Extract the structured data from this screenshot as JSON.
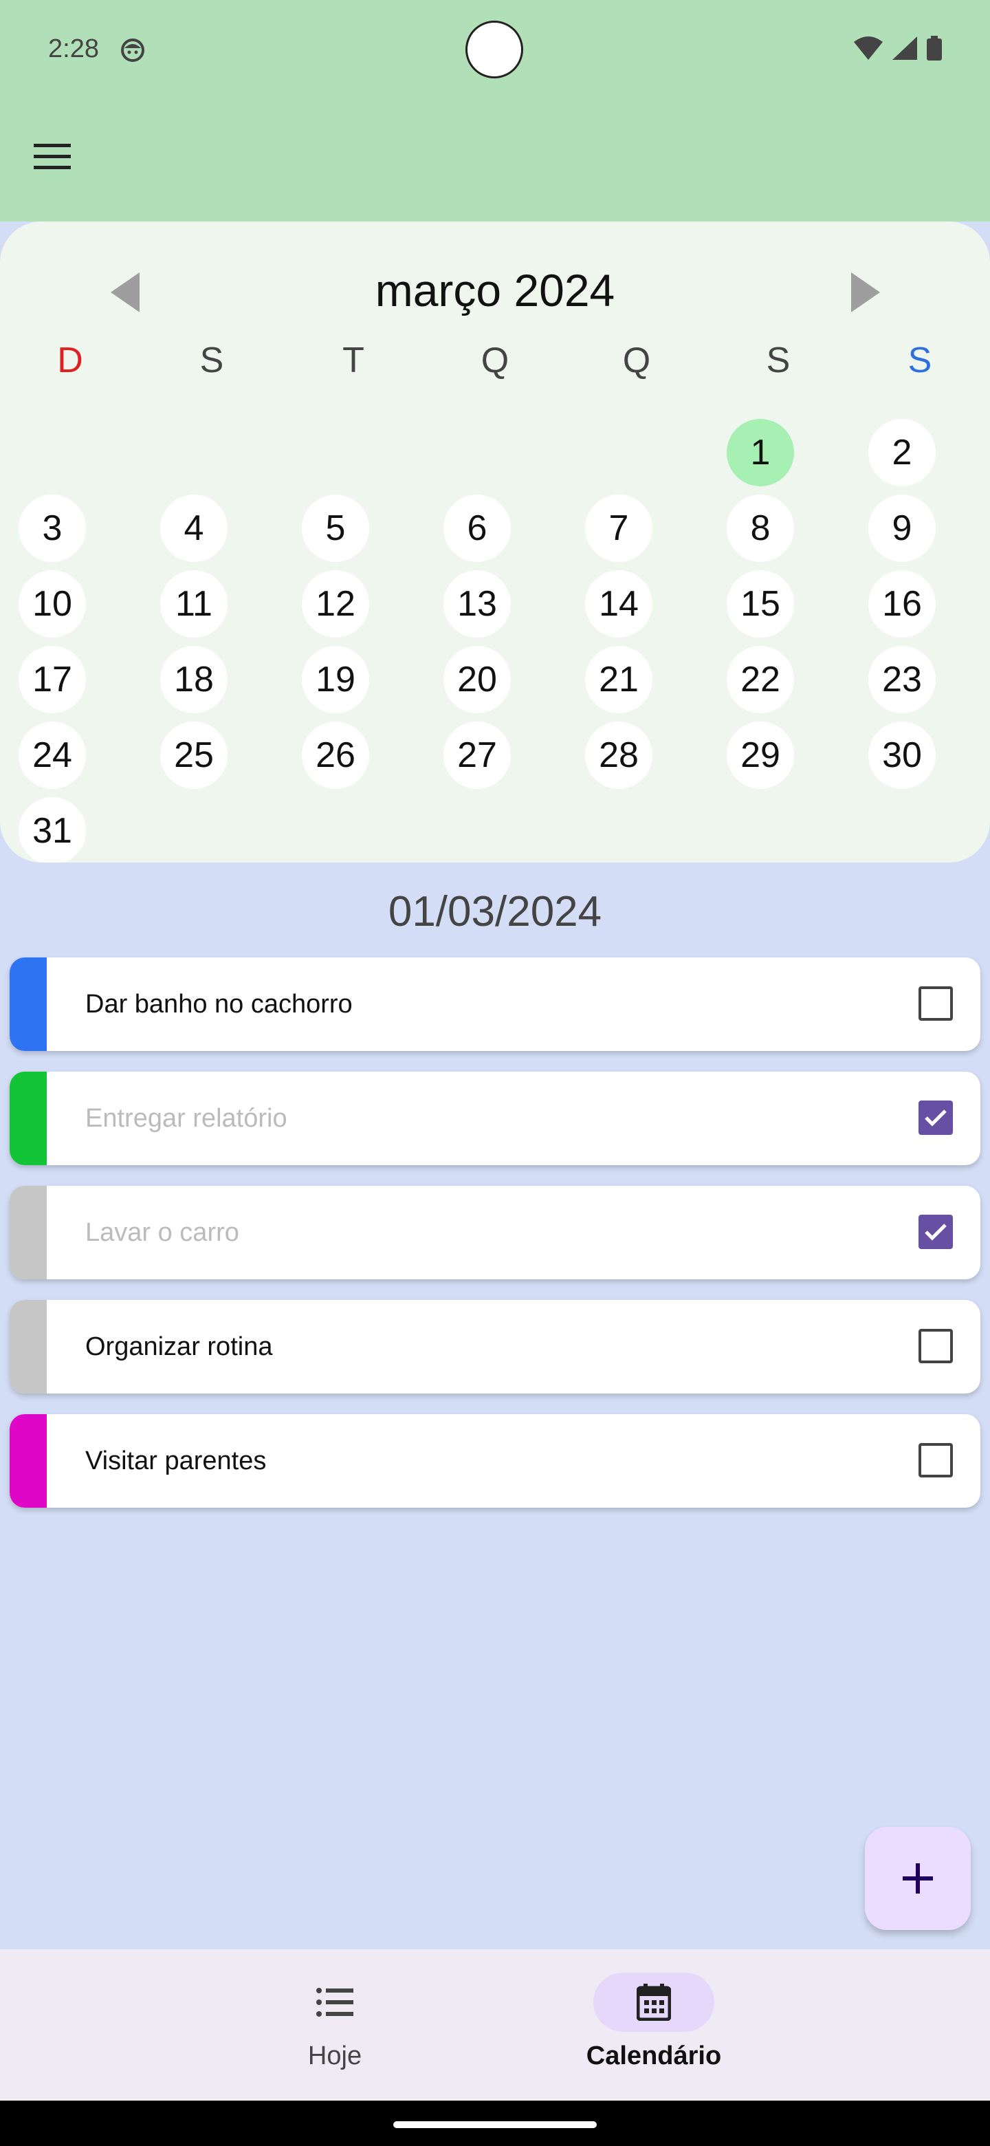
{
  "status_bar": {
    "time": "2:28"
  },
  "calendar": {
    "month_title": "março 2024",
    "weekdays": [
      {
        "label": "D",
        "color": "#e02020"
      },
      {
        "label": "S",
        "color": "#444444"
      },
      {
        "label": "T",
        "color": "#444444"
      },
      {
        "label": "Q",
        "color": "#444444"
      },
      {
        "label": "Q",
        "color": "#444444"
      },
      {
        "label": "S",
        "color": "#444444"
      },
      {
        "label": "S",
        "color": "#2f6fdd"
      }
    ],
    "first_weekday_index": 5,
    "days_in_month": 31,
    "selected_day": 1
  },
  "selected_date": "01/03/2024",
  "tasks": [
    {
      "label": "Dar banho no cachorro",
      "color": "#2e74f2",
      "done": false
    },
    {
      "label": "Entregar relatório",
      "color": "#12c436",
      "done": true
    },
    {
      "label": "Lavar o carro",
      "color": "#c6c6c6",
      "done": true
    },
    {
      "label": "Organizar rotina",
      "color": "#c6c6c6",
      "done": false
    },
    {
      "label": "Visitar parentes",
      "color": "#e006c8",
      "done": false
    }
  ],
  "fab": {
    "icon": "plus-icon"
  },
  "bottom_nav": {
    "items": [
      {
        "label": "Hoje",
        "icon": "list-icon",
        "active": false
      },
      {
        "label": "Calendário",
        "icon": "calendar-icon",
        "active": true
      }
    ]
  }
}
